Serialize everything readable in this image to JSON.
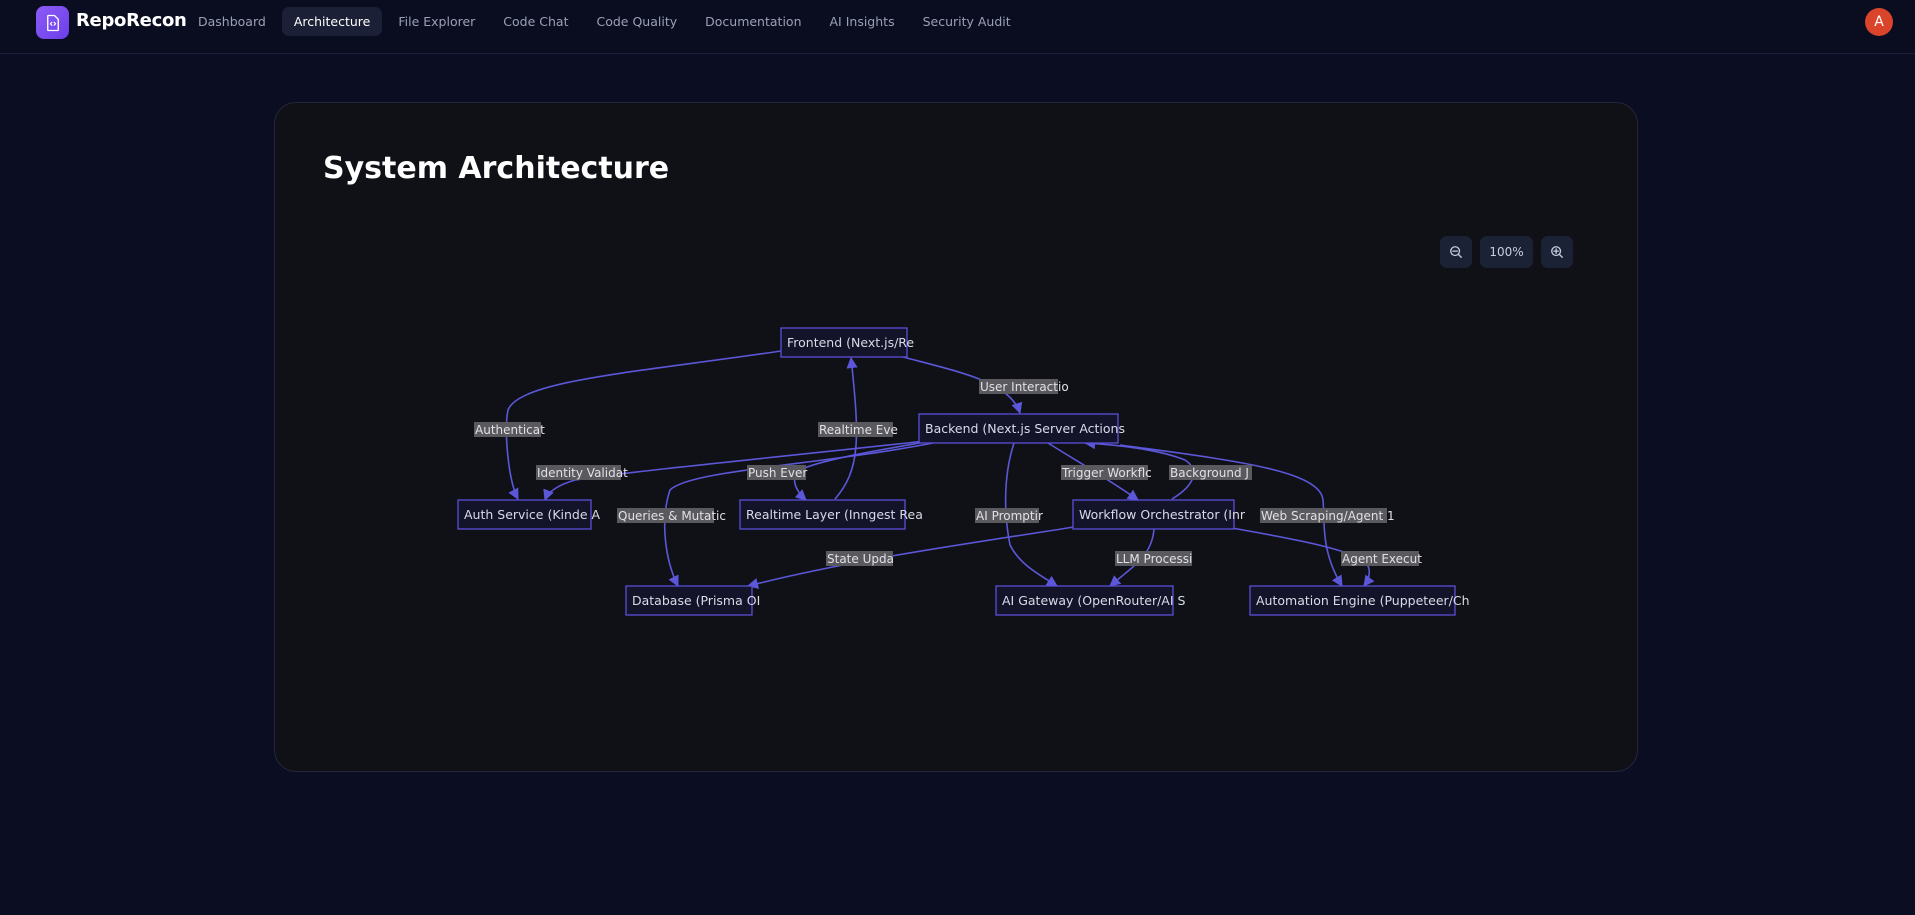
{
  "app": {
    "name": "RepoRecon",
    "avatar_initial": "A",
    "accent": "#8b5cf6"
  },
  "nav": {
    "items": [
      {
        "label": "Dashboard"
      },
      {
        "label": "Architecture"
      },
      {
        "label": "File Explorer"
      },
      {
        "label": "Code Chat"
      },
      {
        "label": "Code Quality"
      },
      {
        "label": "Documentation"
      },
      {
        "label": "AI Insights"
      },
      {
        "label": "Security Audit"
      }
    ],
    "active": "Architecture"
  },
  "page": {
    "title": "System Architecture"
  },
  "zoom": {
    "level": "100%"
  },
  "diagram": {
    "nodes": {
      "frontend": "Frontend (Next.js/Re",
      "backend": "Backend (Next.js Server Actions",
      "auth": "Auth Service (Kinde A",
      "realtime": "Realtime Layer (Inngest Rea",
      "workflow": "Workflow Orchestrator (Inr",
      "database": "Database (Prisma OI",
      "ai_gateway": "AI Gateway (OpenRouter/AI S",
      "automation": "Automation Engine (Puppeteer/Ch"
    },
    "edges": {
      "user_interaction": "User Interactio",
      "authenticate": "Authenticat",
      "realtime_events": "Realtime Eve",
      "identity_validation": "Identity Validat",
      "push_events": "Push Ever",
      "trigger_workflow": "Trigger Workflc",
      "background_jobs": "Background J",
      "queries_mutations": "Queries & Mutatic",
      "ai_prompting": "AI Promptir",
      "web_scraping": "Web Scraping/Agent 1",
      "state_update": "State Upda",
      "llm_processing": "LLM Processi",
      "agent_execution": "Agent Execut"
    }
  }
}
